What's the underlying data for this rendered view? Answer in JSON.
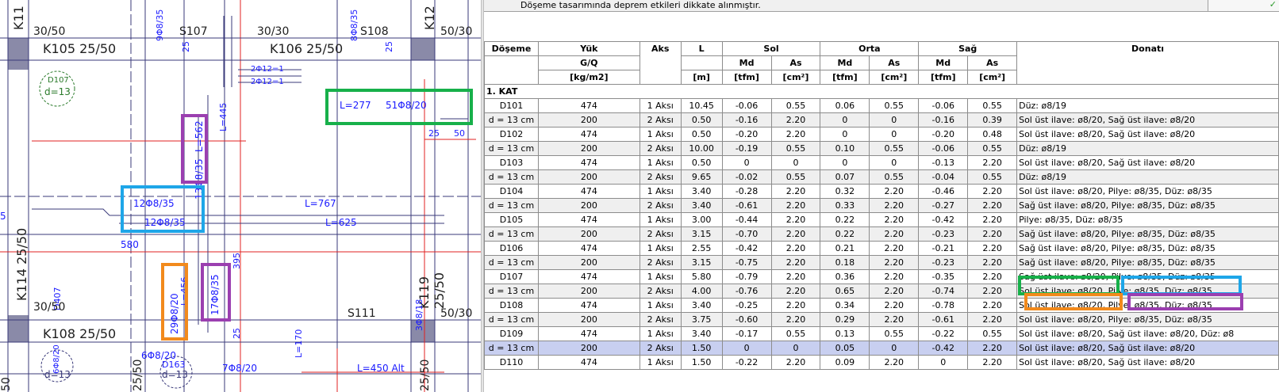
{
  "cad": {
    "labels": {
      "col_k11": "K11",
      "col_k12": "K12",
      "size_30_50_tl": "30/50",
      "s107": "S107",
      "size_30_30": "30/30",
      "s108": "S108",
      "size_50_30_tr": "50/30",
      "beam_k105": "K105 25/50",
      "beam_k106": "K106 25/50",
      "slab_d107": "D107",
      "slab_d107_th": "d=13",
      "bar_9f8_35": "9Φ8/35",
      "bar_8f8_35": "8Φ8/35",
      "bar_2f12_a": "2Φ12=1",
      "bar_2f12_b": "2Φ12=1",
      "bar_25_a": "25",
      "bar_25_b": "25",
      "len_445": "L=445",
      "len_277": "L=277",
      "bar_51f8_20": "51Φ8/20",
      "dim_25": "25",
      "dim_50": "50",
      "len_562": "L=562",
      "bar_13f8_35": "13Φ8/35",
      "bar_12f8_35_a": "12Φ8/35",
      "bar_12f8_35_b": "12Φ8/35",
      "len_767": "L=767",
      "len_625": "L=625",
      "dim_5": "5",
      "dim_580": "580",
      "col_k114": "K114 25/50",
      "slab_d407": "D407",
      "size_30_50_bl": "30/50",
      "bar_29f8_20": "29Φ8/20",
      "len_456": "L=456",
      "bar_17f8_35": "17Φ8/35",
      "dim_395": "395",
      "col_k119": "K119 25/50",
      "bar_3f8_18": "3Φ8/18",
      "size_50_30_br": "50/30",
      "s111": "S111",
      "beam_k108": "K108 25/50",
      "dim_25_c": "25",
      "len_170": "L=170",
      "bar_6f8_20_a": "6Φ8/20",
      "bar_6f8_20_b": "6Φ8/20",
      "slab_d163": "D163",
      "slab_d13_b": "d=13",
      "bar_7f8_20": "7Φ8/20",
      "len_450": "L=450 Alt",
      "col_25_50_b": "25/50",
      "col_25_50_c": "25/50",
      "dim_50_b": "50",
      "dim_d13": "d=13"
    },
    "colors": {
      "background": "#ffffff",
      "grid_line": "#3a3a7a",
      "red_line": "#e02020",
      "rebar_text": "#1a1aff",
      "text": "#202020",
      "column_fill": "#8a8aa8",
      "slab_label": "#2a7a2a"
    }
  },
  "notice": {
    "text": "Döşeme tasarımında deprem etkileri dikkate alınmıştır.",
    "check_icon": "✓"
  },
  "table": {
    "headers": {
      "doseme": "Döşeme",
      "yuk": "Yük",
      "aks": "Aks",
      "l": "L",
      "sol": "Sol",
      "orta": "Orta",
      "sag": "Sağ",
      "donati": "Donatı",
      "gq": "G/Q",
      "kgm2": "[kg/m2]",
      "m": "[m]",
      "md": "Md",
      "as": "As",
      "tfm": "[tfm]",
      "cm2": "[cm²]"
    },
    "section": "1. KAT",
    "rows": [
      {
        "c0": "D101",
        "c1": "474",
        "c2": "1 Aksı",
        "c3": "10.45",
        "c4": "-0.06",
        "c5": "0.55",
        "c6": "0.06",
        "c7": "0.55",
        "c8": "-0.06",
        "c9": "0.55",
        "c10": "Düz: ø8/19"
      },
      {
        "c0": "d = 13 cm",
        "c1": "200",
        "c2": "2 Aksı",
        "c3": "0.50",
        "c4": "-0.16",
        "c5": "2.20",
        "c6": "0",
        "c7": "0",
        "c8": "-0.16",
        "c9": "0.39",
        "c10": "Sol üst ilave: ø8/20,  Sağ üst ilave: ø8/20"
      },
      {
        "c0": "D102",
        "c1": "474",
        "c2": "1 Aksı",
        "c3": "0.50",
        "c4": "-0.20",
        "c5": "2.20",
        "c6": "0",
        "c7": "0",
        "c8": "-0.20",
        "c9": "0.48",
        "c10": "Sol üst ilave: ø8/20,  Sağ üst ilave: ø8/20"
      },
      {
        "c0": "d = 13 cm",
        "c1": "200",
        "c2": "2 Aksı",
        "c3": "10.00",
        "c4": "-0.19",
        "c5": "0.55",
        "c6": "0.10",
        "c7": "0.55",
        "c8": "-0.06",
        "c9": "0.55",
        "c10": "Düz: ø8/19"
      },
      {
        "c0": "D103",
        "c1": "474",
        "c2": "1 Aksı",
        "c3": "0.50",
        "c4": "0",
        "c5": "0",
        "c6": "0",
        "c7": "0",
        "c8": "-0.13",
        "c9": "2.20",
        "c10": "Sol üst ilave: ø8/20,  Sağ üst ilave: ø8/20"
      },
      {
        "c0": "d = 13 cm",
        "c1": "200",
        "c2": "2 Aksı",
        "c3": "9.65",
        "c4": "-0.02",
        "c5": "0.55",
        "c6": "0.07",
        "c7": "0.55",
        "c8": "-0.04",
        "c9": "0.55",
        "c10": "Düz: ø8/19"
      },
      {
        "c0": "D104",
        "c1": "474",
        "c2": "1 Aksı",
        "c3": "3.40",
        "c4": "-0.28",
        "c5": "2.20",
        "c6": "0.32",
        "c7": "2.20",
        "c8": "-0.46",
        "c9": "2.20",
        "c10": "Sol üst ilave: ø8/20,  Pilye: ø8/35,  Düz: ø8/35"
      },
      {
        "c0": "d = 13 cm",
        "c1": "200",
        "c2": "2 Aksı",
        "c3": "3.40",
        "c4": "-0.61",
        "c5": "2.20",
        "c6": "0.33",
        "c7": "2.20",
        "c8": "-0.27",
        "c9": "2.20",
        "c10": "Sağ üst ilave: ø8/20,  Pilye: ø8/35,  Düz: ø8/35"
      },
      {
        "c0": "D105",
        "c1": "474",
        "c2": "1 Aksı",
        "c3": "3.00",
        "c4": "-0.44",
        "c5": "2.20",
        "c6": "0.22",
        "c7": "2.20",
        "c8": "-0.42",
        "c9": "2.20",
        "c10": "Pilye: ø8/35,  Düz: ø8/35"
      },
      {
        "c0": "d = 13 cm",
        "c1": "200",
        "c2": "2 Aksı",
        "c3": "3.15",
        "c4": "-0.70",
        "c5": "2.20",
        "c6": "0.22",
        "c7": "2.20",
        "c8": "-0.23",
        "c9": "2.20",
        "c10": "Sağ üst ilave: ø8/20,  Pilye: ø8/35,  Düz: ø8/35"
      },
      {
        "c0": "D106",
        "c1": "474",
        "c2": "1 Aksı",
        "c3": "2.55",
        "c4": "-0.42",
        "c5": "2.20",
        "c6": "0.21",
        "c7": "2.20",
        "c8": "-0.21",
        "c9": "2.20",
        "c10": "Sağ üst ilave: ø8/20,  Pilye: ø8/35,  Düz: ø8/35"
      },
      {
        "c0": "d = 13 cm",
        "c1": "200",
        "c2": "2 Aksı",
        "c3": "3.15",
        "c4": "-0.75",
        "c5": "2.20",
        "c6": "0.18",
        "c7": "2.20",
        "c8": "-0.23",
        "c9": "2.20",
        "c10": "Sağ üst ilave: ø8/20,  Pilye: ø8/35,  Düz: ø8/35"
      },
      {
        "c0": "D107",
        "c1": "474",
        "c2": "1 Aksı",
        "c3": "5.80",
        "c4": "-0.79",
        "c5": "2.20",
        "c6": "0.36",
        "c7": "2.20",
        "c8": "-0.35",
        "c9": "2.20",
        "c10": "Sağ üst ilave: ø8/20,  Pilye: ø8/35,  Düz: ø8/35"
      },
      {
        "c0": "d = 13 cm",
        "c1": "200",
        "c2": "2 Aksı",
        "c3": "4.00",
        "c4": "-0.76",
        "c5": "2.20",
        "c6": "0.65",
        "c7": "2.20",
        "c8": "-0.74",
        "c9": "2.20",
        "c10": "Sol üst ilave: ø8/20,  Pilye: ø8/35,  Düz: ø8/35"
      },
      {
        "c0": "D108",
        "c1": "474",
        "c2": "1 Aksı",
        "c3": "3.40",
        "c4": "-0.25",
        "c5": "2.20",
        "c6": "0.34",
        "c7": "2.20",
        "c8": "-0.78",
        "c9": "2.20",
        "c10": "Sol üst ilave: ø8/20,  Pilye: ø8/35,  Düz: ø8/35"
      },
      {
        "c0": "d = 13 cm",
        "c1": "200",
        "c2": "2 Aksı",
        "c3": "3.75",
        "c4": "-0.60",
        "c5": "2.20",
        "c6": "0.29",
        "c7": "2.20",
        "c8": "-0.61",
        "c9": "2.20",
        "c10": "Sol üst ilave: ø8/20,  Pilye: ø8/35,  Düz: ø8/35"
      },
      {
        "c0": "D109",
        "c1": "474",
        "c2": "1 Aksı",
        "c3": "3.40",
        "c4": "-0.17",
        "c5": "0.55",
        "c6": "0.13",
        "c7": "0.55",
        "c8": "-0.22",
        "c9": "0.55",
        "c10": "Sol üst ilave: ø8/20,  Sağ üst ilave: ø8/20,  Düz: ø8"
      },
      {
        "c0": "d = 13 cm",
        "c1": "200",
        "c2": "2 Aksı",
        "c3": "1.50",
        "c4": "0",
        "c5": "0",
        "c6": "0.05",
        "c7": "0",
        "c8": "-0.42",
        "c9": "2.20",
        "c10": "Sol üst ilave: ø8/20,  Sağ üst ilave: ø8/20"
      },
      {
        "c0": "D110",
        "c1": "474",
        "c2": "1 Aksı",
        "c3": "1.50",
        "c4": "-0.22",
        "c5": "2.20",
        "c6": "0.09",
        "c7": "2.20",
        "c8": "0",
        "c9": "2.20",
        "c10": "Sol üst ilave: ø8/20,  Sağ üst ilave: ø8/20"
      }
    ],
    "selected_row_index": 17
  },
  "highlights": {
    "green": "#17b04a",
    "blue": "#1ea6e8",
    "purple": "#9b3fb0",
    "orange": "#f28a1c"
  }
}
